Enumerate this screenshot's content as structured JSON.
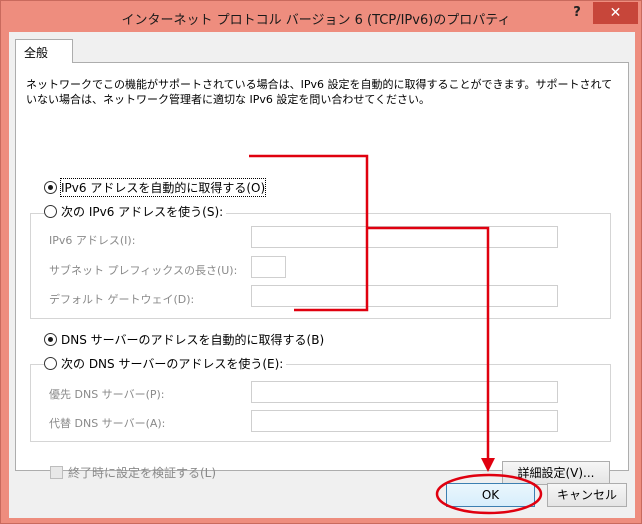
{
  "window": {
    "title": "インターネット プロトコル バージョン 6 (TCP/IPv6)のプロパティ",
    "help_label": "?",
    "close_label": "✕"
  },
  "tabs": [
    {
      "label": "全般"
    }
  ],
  "description": "ネットワークでこの機能がサポートされている場合は、IPv6 設定を自動的に取得することができます。サポートされていない場合は、ネットワーク管理者に適切な IPv6 設定を問い合わせてください。",
  "ip": {
    "auto_label": "IPv6 アドレスを自動的に取得する(O)",
    "manual_label": "次の IPv6 アドレスを使う(S):",
    "selected": "auto",
    "fields": [
      {
        "label": "IPv6 アドレス(I):",
        "value": ""
      },
      {
        "label": "サブネット プレフィックスの長さ(U):",
        "value": ""
      },
      {
        "label": "デフォルト ゲートウェイ(D):",
        "value": ""
      }
    ]
  },
  "dns": {
    "auto_label": "DNS サーバーのアドレスを自動的に取得する(B)",
    "manual_label": "次の DNS サーバーのアドレスを使う(E):",
    "selected": "auto",
    "fields": [
      {
        "label": "優先 DNS サーバー(P):",
        "value": ""
      },
      {
        "label": "代替 DNS サーバー(A):",
        "value": ""
      }
    ]
  },
  "validate_label": "終了時に設定を検証する(L)",
  "validate_checked": false,
  "advanced_label": "詳細設定(V)...",
  "ok_label": "OK",
  "cancel_label": "キャンセル",
  "colors": {
    "annotation": "#e0000f",
    "close_button": "#c7463a",
    "window_frame": "#ee8d7e"
  }
}
